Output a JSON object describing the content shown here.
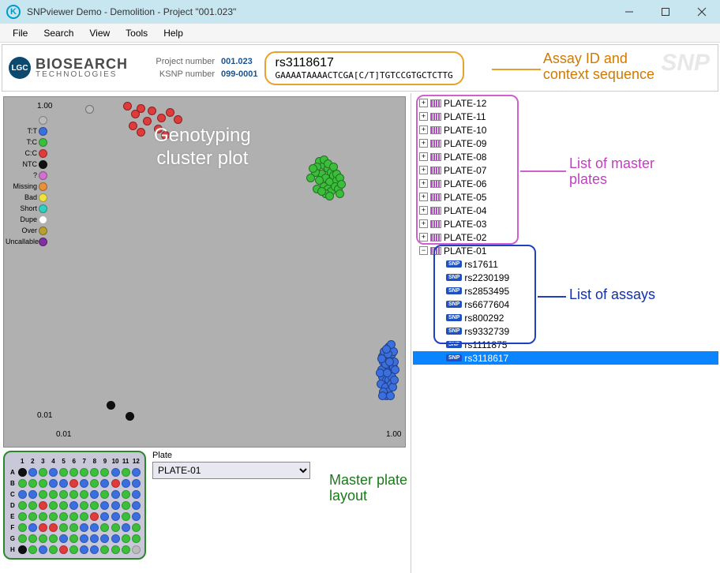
{
  "window": {
    "title": "SNPviewer    Demo - Demolition - Project \"001.023\""
  },
  "menu": [
    "File",
    "Search",
    "View",
    "Tools",
    "Help"
  ],
  "header": {
    "logo_main": "BIOSEARCH",
    "logo_sub": "TECHNOLOGIES",
    "lgc": "LGC",
    "project_label": "Project number",
    "project_value": "001.023",
    "ksnp_label": "KSNP number",
    "ksnp_value": "099-0001",
    "assay_id": "rs3118617",
    "context_seq": "GAAAATAAAACTCGA[C/T]TGTCCGTGCTCTTG",
    "ghost": "SNP"
  },
  "annotations": {
    "assay": "Assay ID and\ncontext sequence",
    "cluster": "Genotyping\ncluster plot",
    "plates": "List of master\nplates",
    "assays": "List of assays",
    "layout": "Master plate\nlayout"
  },
  "legend": [
    {
      "label": "",
      "color": "#bbbbbb"
    },
    {
      "label": "T:T",
      "color": "#3b6fe0"
    },
    {
      "label": "T:C",
      "color": "#3bbf3b"
    },
    {
      "label": "C:C",
      "color": "#e03b3b"
    },
    {
      "label": "NTC",
      "color": "#101010"
    },
    {
      "label": "?",
      "color": "#d070d0"
    },
    {
      "label": "Missing",
      "color": "#e8903a"
    },
    {
      "label": "Bad",
      "color": "#f0e040"
    },
    {
      "label": "Short",
      "color": "#30d0c0"
    },
    {
      "label": "Dupe",
      "color": "#ffffff"
    },
    {
      "label": "Over",
      "color": "#b8a030"
    },
    {
      "label": "Uncallable",
      "color": "#8030a0"
    }
  ],
  "axes": {
    "y_top": "1.00",
    "y_bot": "0.01",
    "x_left": "0.01",
    "x_right": "1.00"
  },
  "plates": [
    "PLATE-12",
    "PLATE-11",
    "PLATE-10",
    "PLATE-09",
    "PLATE-08",
    "PLATE-07",
    "PLATE-06",
    "PLATE-05",
    "PLATE-04",
    "PLATE-03",
    "PLATE-02",
    "PLATE-01"
  ],
  "assays": [
    "rs17611",
    "rs2230199",
    "rs2853495",
    "rs6677604",
    "rs800292",
    "rs9332739",
    "rs1111875",
    "rs3118617"
  ],
  "selected_assay": "rs3118617",
  "plate_selector": {
    "label": "Plate",
    "value": "PLATE-01"
  },
  "plate_rows": [
    "A",
    "B",
    "C",
    "D",
    "E",
    "F",
    "G",
    "H"
  ],
  "plate_cols": [
    "1",
    "2",
    "3",
    "4",
    "5",
    "6",
    "7",
    "8",
    "9",
    "10",
    "11",
    "12"
  ],
  "plate_layout": [
    [
      "k",
      "b",
      "g",
      "b",
      "g",
      "g",
      "g",
      "g",
      "g",
      "b",
      "g",
      "b"
    ],
    [
      "g",
      "g",
      "g",
      "b",
      "b",
      "r",
      "b",
      "g",
      "b",
      "r",
      "b",
      "b"
    ],
    [
      "b",
      "b",
      "g",
      "g",
      "g",
      "g",
      "g",
      "b",
      "g",
      "b",
      "g",
      "b"
    ],
    [
      "g",
      "g",
      "r",
      "g",
      "g",
      "b",
      "g",
      "g",
      "b",
      "b",
      "g",
      "b"
    ],
    [
      "g",
      "g",
      "g",
      "g",
      "g",
      "g",
      "g",
      "r",
      "b",
      "b",
      "g",
      "b"
    ],
    [
      "g",
      "b",
      "r",
      "r",
      "g",
      "g",
      "b",
      "b",
      "g",
      "g",
      "b",
      "g"
    ],
    [
      "g",
      "g",
      "g",
      "g",
      "b",
      "g",
      "b",
      "b",
      "b",
      "b",
      "g",
      "g"
    ],
    [
      "k",
      "g",
      "b",
      "g",
      "r",
      "g",
      "b",
      "b",
      "g",
      "g",
      "g",
      "x"
    ]
  ],
  "well_colors": {
    "k": "#101010",
    "b": "#3b6fe0",
    "g": "#3bbf3b",
    "r": "#e03b3b",
    "x": "#bbbbbb"
  },
  "chart_data": {
    "type": "scatter",
    "title": "Genotyping cluster plot",
    "xlabel": "",
    "ylabel": "",
    "xlim": [
      0.01,
      1.0
    ],
    "ylim": [
      0.01,
      1.0
    ],
    "xscale": "log",
    "yscale": "log",
    "series": [
      {
        "name": "C:C",
        "color": "#e03b3b",
        "points": [
          [
            0.025,
            0.97
          ],
          [
            0.03,
            0.93
          ],
          [
            0.035,
            0.9
          ],
          [
            0.028,
            0.86
          ],
          [
            0.04,
            0.82
          ],
          [
            0.033,
            0.78
          ],
          [
            0.045,
            0.88
          ],
          [
            0.027,
            0.73
          ],
          [
            0.05,
            0.8
          ],
          [
            0.038,
            0.7
          ],
          [
            0.03,
            0.67
          ],
          [
            0.042,
            0.64
          ]
        ]
      },
      {
        "name": "T:C",
        "color": "#3bbf3b",
        "points": [
          [
            0.34,
            0.44
          ],
          [
            0.36,
            0.42
          ],
          [
            0.38,
            0.4
          ],
          [
            0.4,
            0.38
          ],
          [
            0.35,
            0.37
          ],
          [
            0.37,
            0.35
          ],
          [
            0.39,
            0.33
          ],
          [
            0.33,
            0.41
          ],
          [
            0.41,
            0.36
          ],
          [
            0.43,
            0.34
          ],
          [
            0.36,
            0.31
          ],
          [
            0.38,
            0.3
          ],
          [
            0.4,
            0.29
          ],
          [
            0.42,
            0.31
          ],
          [
            0.44,
            0.3
          ],
          [
            0.34,
            0.34
          ],
          [
            0.32,
            0.38
          ],
          [
            0.45,
            0.28
          ],
          [
            0.37,
            0.28
          ],
          [
            0.39,
            0.27
          ],
          [
            0.36,
            0.45
          ],
          [
            0.31,
            0.4
          ],
          [
            0.43,
            0.37
          ],
          [
            0.45,
            0.35
          ],
          [
            0.33,
            0.3
          ],
          [
            0.35,
            0.29
          ],
          [
            0.38,
            0.43
          ],
          [
            0.41,
            0.41
          ],
          [
            0.3,
            0.35
          ],
          [
            0.46,
            0.32
          ]
        ]
      },
      {
        "name": "T:T",
        "color": "#3b6fe0",
        "points": [
          [
            0.8,
            0.021
          ],
          [
            0.82,
            0.023
          ],
          [
            0.84,
            0.02
          ],
          [
            0.86,
            0.024
          ],
          [
            0.88,
            0.022
          ],
          [
            0.9,
            0.025
          ],
          [
            0.92,
            0.023
          ],
          [
            0.78,
            0.019
          ],
          [
            0.81,
            0.026
          ],
          [
            0.83,
            0.018
          ],
          [
            0.85,
            0.027
          ],
          [
            0.87,
            0.02
          ],
          [
            0.89,
            0.028
          ],
          [
            0.91,
            0.021
          ],
          [
            0.93,
            0.024
          ],
          [
            0.79,
            0.023
          ],
          [
            0.94,
            0.026
          ],
          [
            0.8,
            0.028
          ],
          [
            0.86,
            0.017
          ],
          [
            0.9,
            0.019
          ],
          [
            0.77,
            0.022
          ],
          [
            0.95,
            0.023
          ],
          [
            0.82,
            0.03
          ],
          [
            0.88,
            0.031
          ],
          [
            0.84,
            0.016
          ],
          [
            0.91,
            0.029
          ],
          [
            0.87,
            0.032
          ],
          [
            0.83,
            0.025
          ],
          [
            0.89,
            0.016
          ],
          [
            0.93,
            0.03
          ],
          [
            0.85,
            0.022
          ],
          [
            0.79,
            0.027
          ],
          [
            0.81,
            0.017
          ],
          [
            0.9,
            0.033
          ],
          [
            0.86,
            0.029
          ],
          [
            0.92,
            0.018
          ],
          [
            0.88,
            0.026
          ],
          [
            0.84,
            0.031
          ],
          [
            0.8,
            0.016
          ],
          [
            0.94,
            0.02
          ]
        ]
      },
      {
        "name": "NTC",
        "color": "#101010",
        "points": [
          [
            0.02,
            0.014
          ],
          [
            0.026,
            0.012
          ]
        ]
      },
      {
        "name": "?",
        "color": "#bbbbbb",
        "points": [
          [
            0.015,
            0.92
          ]
        ]
      }
    ]
  }
}
